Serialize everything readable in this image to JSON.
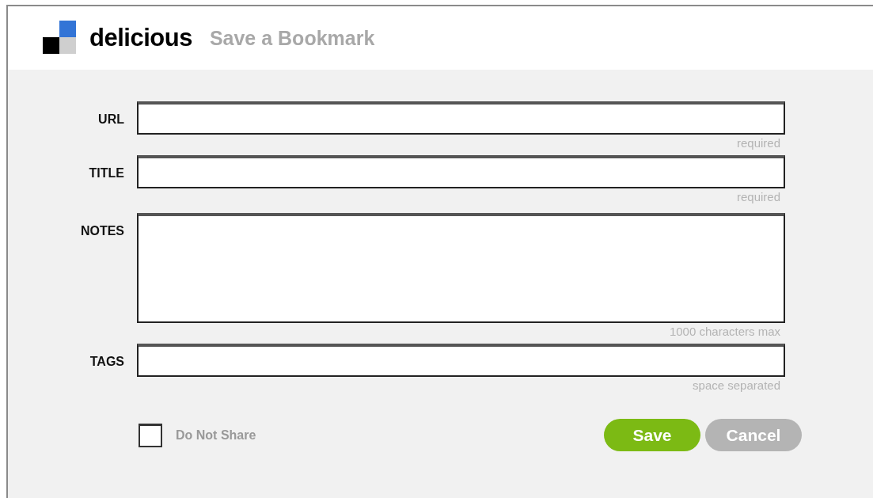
{
  "header": {
    "brand": "delicious",
    "title": "Save a Bookmark"
  },
  "fields": [
    {
      "label": "URL",
      "kind": "text",
      "hint": "required"
    },
    {
      "label": "TITLE",
      "kind": "text",
      "hint": "required"
    },
    {
      "label": "NOTES",
      "kind": "multiline",
      "hint": "1000 characters max"
    },
    {
      "label": "TAGS",
      "kind": "text",
      "hint": "space separated"
    }
  ],
  "share": {
    "label": "Do Not Share",
    "checked": false
  },
  "buttons": [
    {
      "label": "Save",
      "kind": "primary"
    },
    {
      "label": "Cancel",
      "kind": "secondary"
    }
  ]
}
